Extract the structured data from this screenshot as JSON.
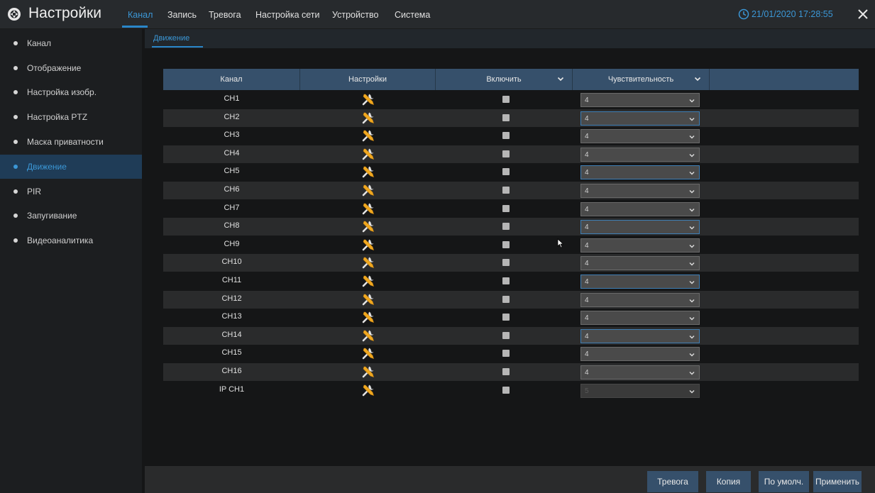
{
  "header": {
    "title": "Настройки",
    "tabs": [
      {
        "label": "Канал",
        "active": true
      },
      {
        "label": "Запись",
        "active": false
      },
      {
        "label": "Тревога",
        "active": false
      },
      {
        "label": "Настройка сети",
        "active": false
      },
      {
        "label": "Устройство",
        "active": false
      },
      {
        "label": "Система",
        "active": false
      }
    ],
    "datetime": "21/01/2020 17:28:55"
  },
  "sidebar": {
    "items": [
      {
        "label": "Канал",
        "active": false
      },
      {
        "label": "Отображение",
        "active": false
      },
      {
        "label": "Настройка изобр.",
        "active": false
      },
      {
        "label": "Настройка PTZ",
        "active": false
      },
      {
        "label": "Маска приватности",
        "active": false
      },
      {
        "label": "Движение",
        "active": true
      },
      {
        "label": "PIR",
        "active": false
      },
      {
        "label": "Запугивание",
        "active": false
      },
      {
        "label": "Видеоаналитика",
        "active": false
      }
    ]
  },
  "subtab": {
    "label": "Движение"
  },
  "table": {
    "columns": [
      "Канал",
      "Настройки",
      "Включить",
      "Чувствительность"
    ],
    "rows": [
      {
        "channel": "CH1",
        "enabled": true,
        "sensitivity": "4",
        "disabled": false
      },
      {
        "channel": "CH2",
        "enabled": true,
        "sensitivity": "4",
        "disabled": false
      },
      {
        "channel": "CH3",
        "enabled": true,
        "sensitivity": "4",
        "disabled": false
      },
      {
        "channel": "CH4",
        "enabled": true,
        "sensitivity": "4",
        "disabled": false
      },
      {
        "channel": "CH5",
        "enabled": true,
        "sensitivity": "4",
        "disabled": false
      },
      {
        "channel": "CH6",
        "enabled": true,
        "sensitivity": "4",
        "disabled": false
      },
      {
        "channel": "CH7",
        "enabled": true,
        "sensitivity": "4",
        "disabled": false
      },
      {
        "channel": "CH8",
        "enabled": true,
        "sensitivity": "4",
        "disabled": false
      },
      {
        "channel": "CH9",
        "enabled": true,
        "sensitivity": "4",
        "disabled": false
      },
      {
        "channel": "CH10",
        "enabled": true,
        "sensitivity": "4",
        "disabled": false
      },
      {
        "channel": "CH11",
        "enabled": true,
        "sensitivity": "4",
        "disabled": false
      },
      {
        "channel": "CH12",
        "enabled": true,
        "sensitivity": "4",
        "disabled": false
      },
      {
        "channel": "CH13",
        "enabled": true,
        "sensitivity": "4",
        "disabled": false
      },
      {
        "channel": "CH14",
        "enabled": true,
        "sensitivity": "4",
        "disabled": false
      },
      {
        "channel": "CH15",
        "enabled": true,
        "sensitivity": "4",
        "disabled": false
      },
      {
        "channel": "CH16",
        "enabled": true,
        "sensitivity": "4",
        "disabled": false
      },
      {
        "channel": "IP CH1",
        "enabled": true,
        "sensitivity": "5",
        "disabled": true
      }
    ]
  },
  "buttons": {
    "alarm": "Тревога",
    "copy": "Копия",
    "default": "По умолч.",
    "apply": "Применить"
  },
  "colors": {
    "accent": "#3b97d6",
    "header_bg": "#36506b",
    "active_sidebar_bg": "#1f3c57"
  },
  "icons": {
    "logo": "camera-lens-icon",
    "clock": "clock-icon",
    "close": "close-icon",
    "settings": "wrench-screwdriver-icon",
    "dropdown": "chevron-down-icon"
  }
}
